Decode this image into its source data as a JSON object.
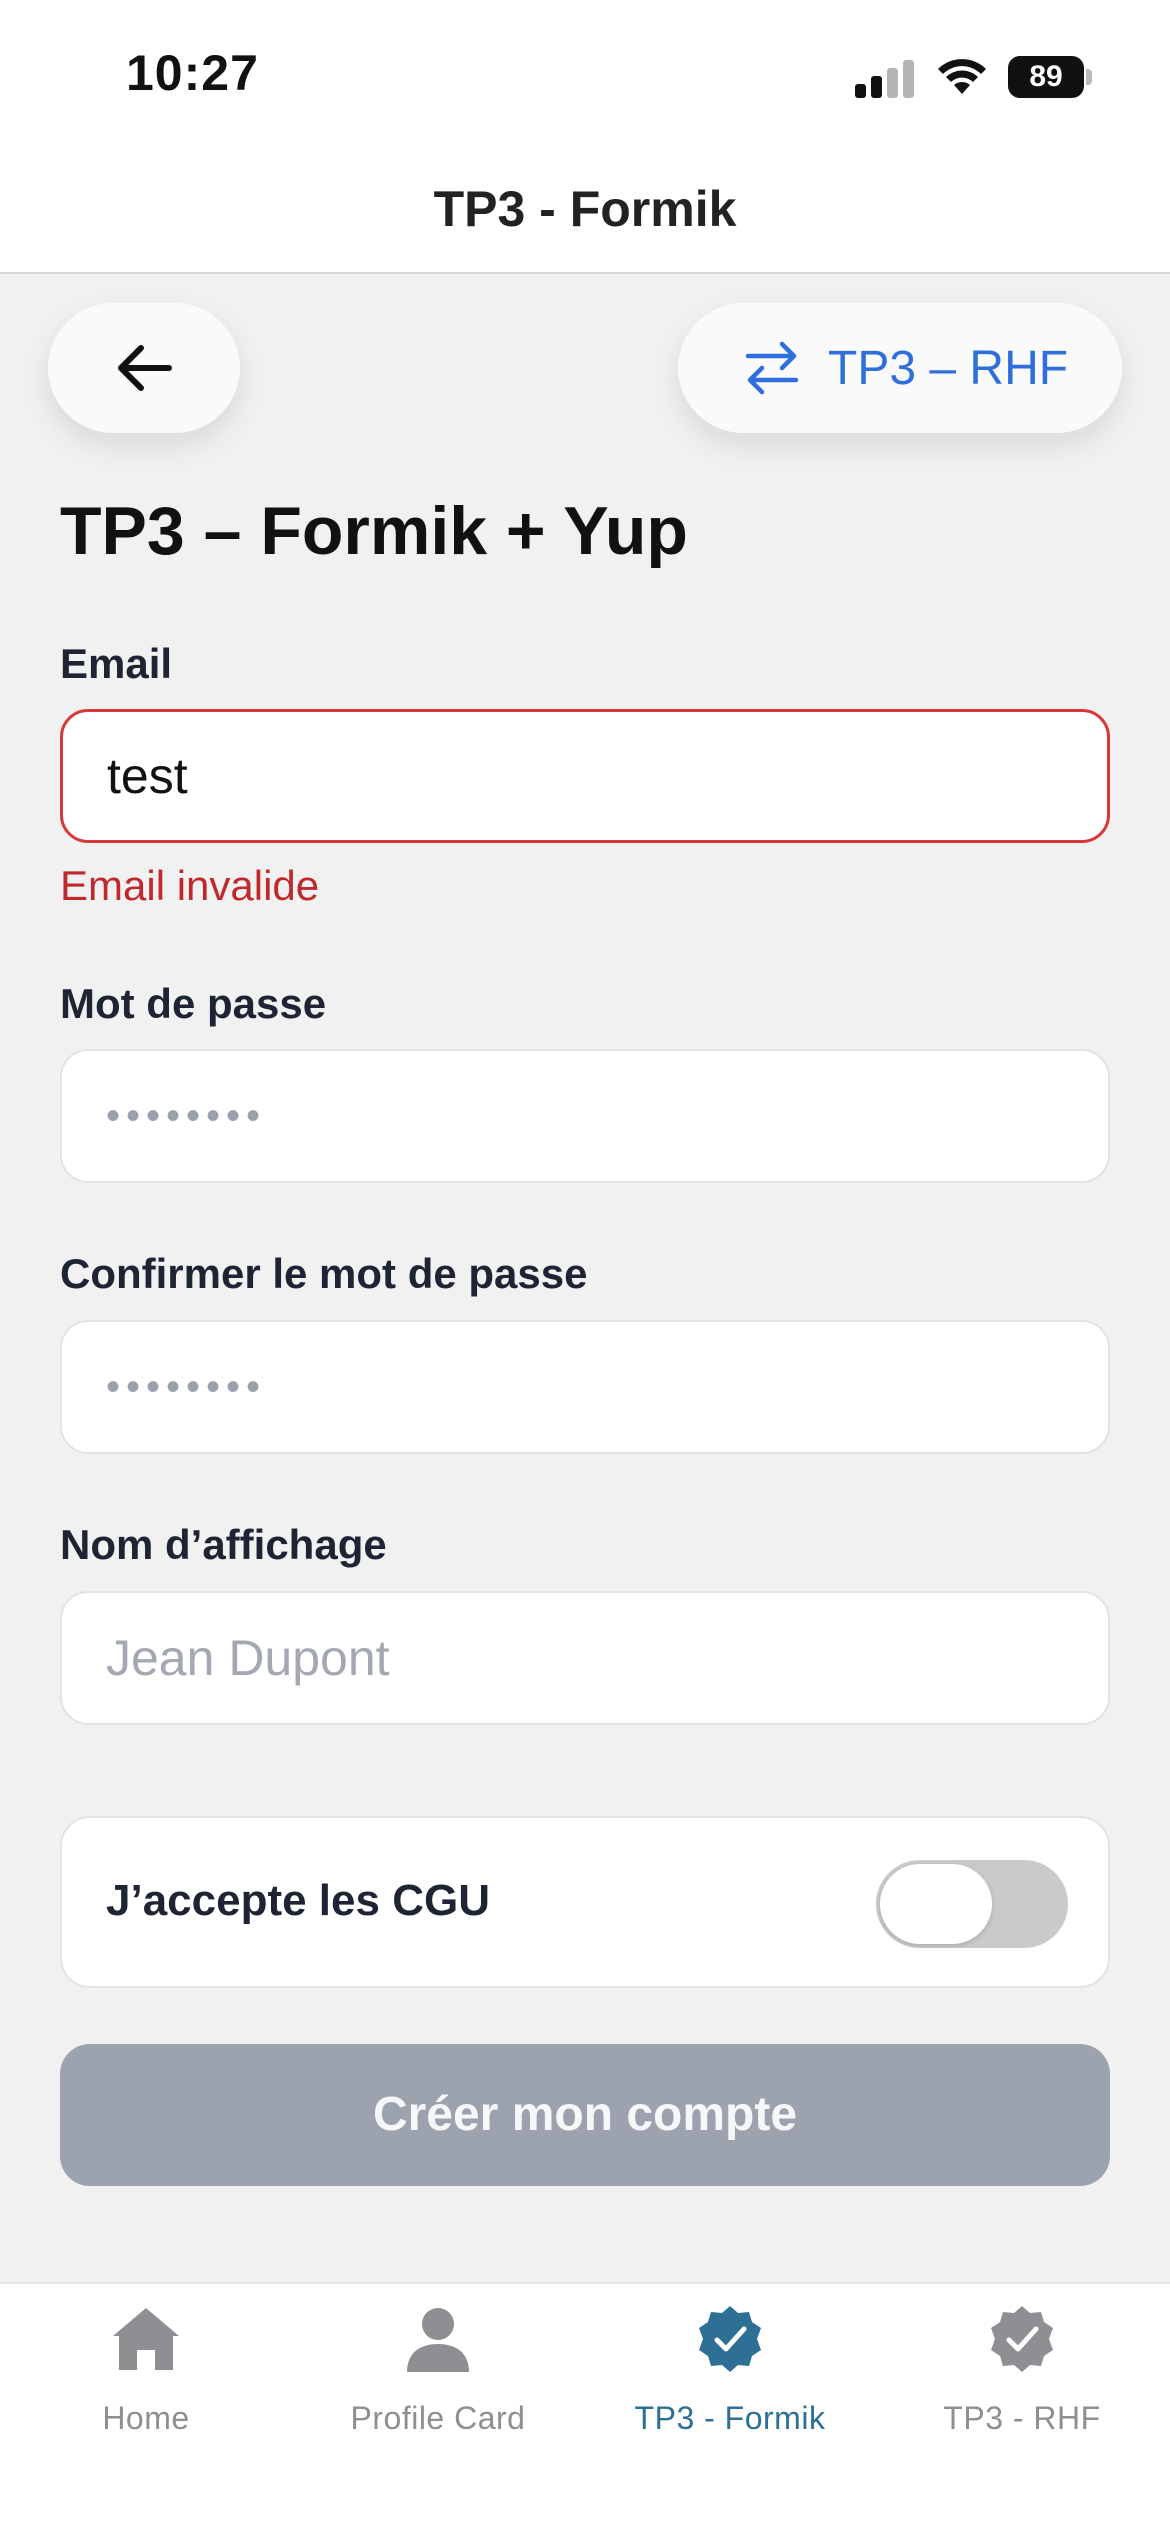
{
  "status_bar": {
    "time": "10:27",
    "battery": "89"
  },
  "header": {
    "title": "TP3 - Formik"
  },
  "actions": {
    "back_icon": "arrow-left-icon",
    "switch_label": "TP3 – RHF",
    "switch_icon": "swap-arrows-icon"
  },
  "page": {
    "title": "TP3 – Formik + Yup"
  },
  "form": {
    "email": {
      "label": "Email",
      "value": "test",
      "error": "Email invalide"
    },
    "password": {
      "label": "Mot de passe",
      "value": "••••••••"
    },
    "confirm_password": {
      "label": "Confirmer le mot de passe",
      "value": "••••••••"
    },
    "display_name": {
      "label": "Nom d’affichage",
      "placeholder": "Jean Dupont"
    },
    "cgu": {
      "label": "J’accepte les CGU",
      "checked": false
    },
    "submit_label": "Créer mon compte"
  },
  "tabs": [
    {
      "label": "Home",
      "icon": "home-icon",
      "active": false
    },
    {
      "label": "Profile Card",
      "icon": "person-icon",
      "active": false
    },
    {
      "label": "TP3 - Formik",
      "icon": "verified-badge-icon",
      "active": true
    },
    {
      "label": "TP3 - RHF",
      "icon": "verified-badge-icon",
      "active": false
    }
  ],
  "colors": {
    "accent": "#2f6fdc",
    "error": "#d9383a",
    "tab_active": "#2d6f95",
    "disabled_button": "#9ca3ae"
  }
}
